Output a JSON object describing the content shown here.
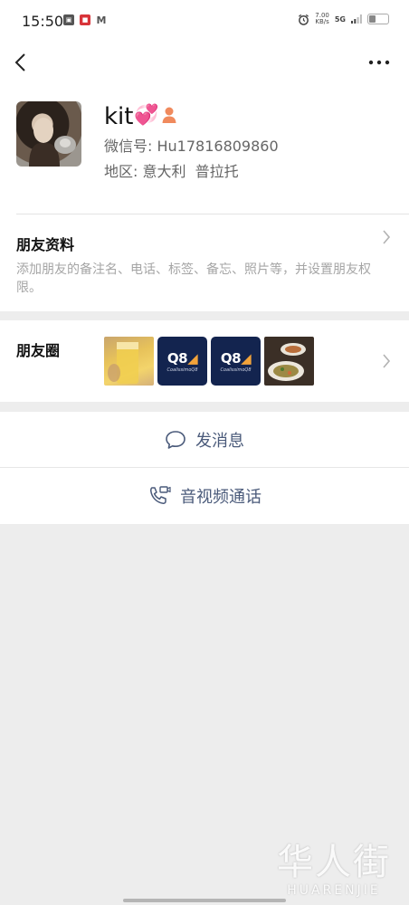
{
  "status_bar": {
    "time": "15:50",
    "net_speed": "7.00",
    "net_speed_unit": "KB/s",
    "network": "5G",
    "battery_level": 0.35,
    "left_icons": [
      "gallery-icon",
      "app-badge-icon",
      "mail-m-icon"
    ],
    "right_icons": [
      "alarm-icon",
      "signal-icon",
      "battery-icon"
    ]
  },
  "nav": {
    "back_icon": "back-chevron-icon",
    "more_icon": "more-dots-icon"
  },
  "profile": {
    "nickname": "kit",
    "nickname_emoji": "💞",
    "wechat_id_label": "微信号:",
    "wechat_id": "Hu17816809860",
    "region_label": "地区:",
    "region": "意大利  普拉托",
    "gender_color": "#f08a5d"
  },
  "friend_info": {
    "title": "朋友资料",
    "description": "添加朋友的备注名、电话、标签、备忘、照片等，并设置朋友权限。"
  },
  "moments": {
    "title": "朋友圈",
    "thumbnails": [
      {
        "kind": "photo-drink"
      },
      {
        "kind": "q8-logo",
        "logo": "Q8",
        "subtitle": "CoalissimoQ8"
      },
      {
        "kind": "q8-logo",
        "logo": "Q8",
        "subtitle": "CoalissimoQ8"
      },
      {
        "kind": "photo-food"
      }
    ]
  },
  "actions": {
    "message": "发消息",
    "call": "音视频通话"
  },
  "watermark": {
    "cn": "华人街",
    "en": "HUARENJIE"
  },
  "colors": {
    "background": "#ededed",
    "card": "#ffffff",
    "action_text": "#4a5a7a",
    "muted_text": "#a5a5a5"
  }
}
